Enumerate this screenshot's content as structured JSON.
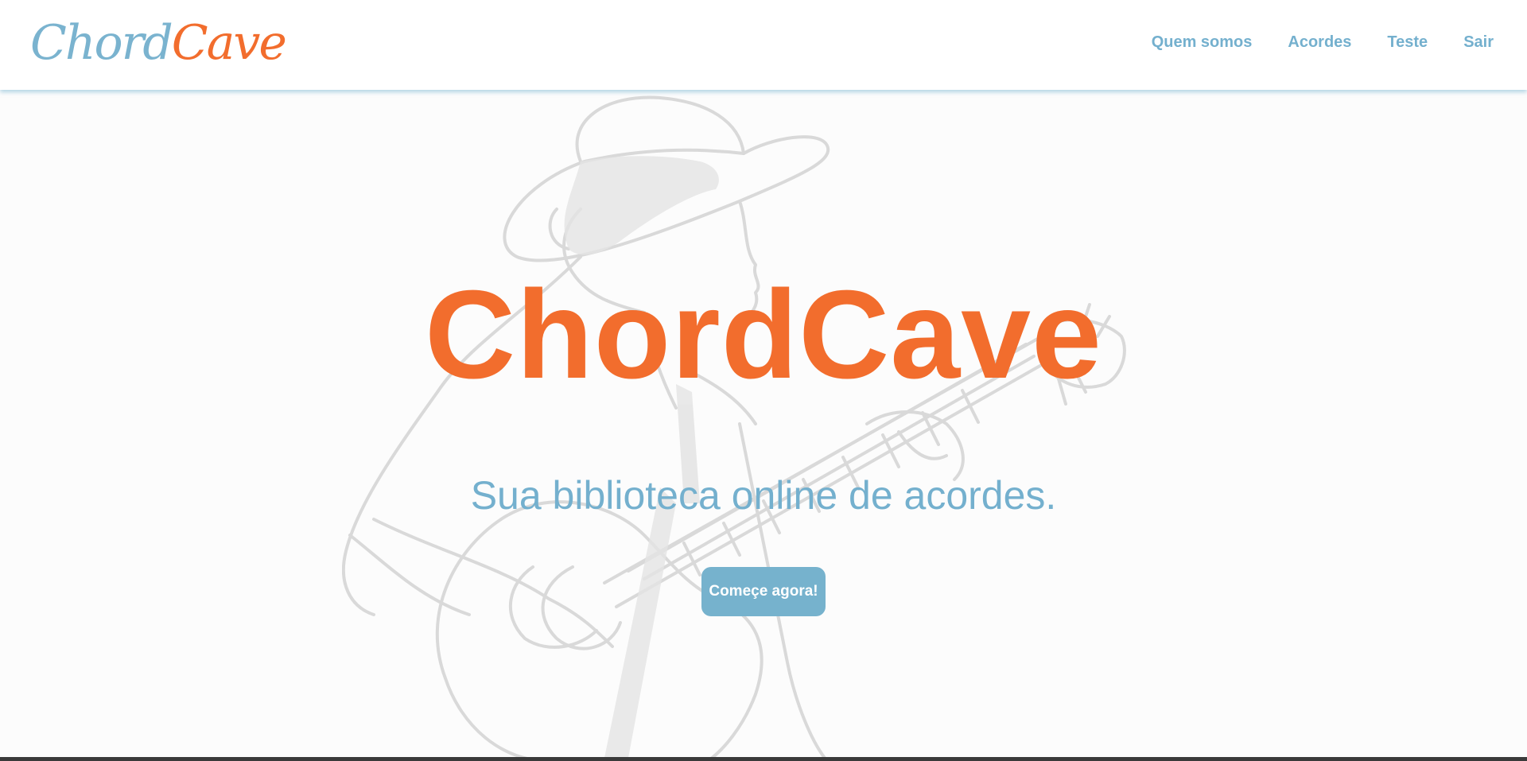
{
  "header": {
    "logo_part1": "Chord",
    "logo_part2": "Cave",
    "nav": [
      {
        "label": "Quem somos"
      },
      {
        "label": "Acordes"
      },
      {
        "label": "Teste"
      },
      {
        "label": "Sair"
      }
    ]
  },
  "hero": {
    "title": "ChordCave",
    "subtitle": "Sua biblioteca online de acordes.",
    "cta_label": "Começe agora!",
    "illustration_icon": "guitar-player-illustration"
  },
  "colors": {
    "orange": "#f26d2d",
    "blue": "#74b0ce",
    "button_bg": "#76b2cd"
  }
}
